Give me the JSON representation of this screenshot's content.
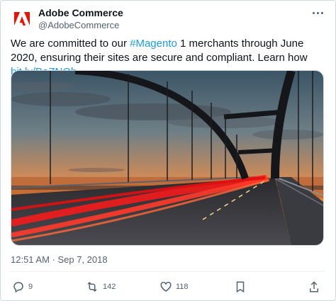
{
  "account": {
    "display_name": "Adobe Commerce",
    "handle": "@AdobeCommerce"
  },
  "tweet": {
    "text_part1": "We are committed to our ",
    "hashtag": "#Magento",
    "text_part2": " 1 merchants through June 2020, ensuring their sites are secure and compliant. Learn how ",
    "link": "bit.ly/BaZNOb"
  },
  "timestamp": "12:51 AM · Sep 7, 2018",
  "actions": {
    "replies": "9",
    "retweets": "142",
    "likes": "118"
  },
  "icons": {
    "logo": "adobe-logo-icon",
    "more": "more-options-icon",
    "reply": "reply-icon",
    "retweet": "retweet-icon",
    "like": "heart-icon",
    "bookmark": "bookmark-icon",
    "share": "share-icon"
  },
  "colors": {
    "brand_red": "#eb1000",
    "link_blue": "#1d9bf0",
    "secondary_text": "#536471"
  }
}
